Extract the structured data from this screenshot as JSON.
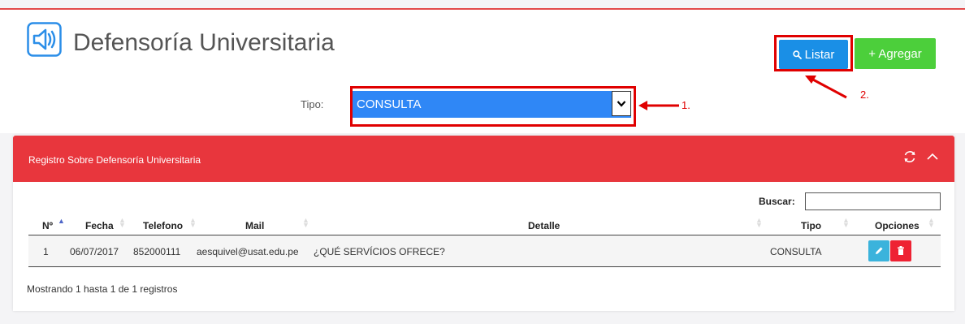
{
  "app": {
    "title": "Defensoría Universitaria"
  },
  "toolbar": {
    "listar_label": "Listar",
    "agregar_label": "+ Agregar"
  },
  "filter": {
    "label": "Tipo:",
    "selected": "CONSULTA"
  },
  "annotations": {
    "a1": "1.",
    "a2": "2."
  },
  "panel": {
    "title": "Registro Sobre Defensoría Universitaria",
    "search_label": "Buscar:",
    "search_value": ""
  },
  "table": {
    "headers": {
      "num": "Nº",
      "fecha": "Fecha",
      "telefono": "Telefono",
      "mail": "Mail",
      "detalle": "Detalle",
      "tipo": "Tipo",
      "opciones": "Opciones"
    },
    "rows": [
      {
        "num": "1",
        "fecha": "06/07/2017",
        "telefono": "852000111",
        "mail": "aesquivel@usat.edu.pe",
        "detalle": "¿QUÉ SERVÍCIOS OFRECE?",
        "tipo": "CONSULTA"
      }
    ]
  },
  "info": "Mostrando 1 hasta 1 de 1 registros",
  "colors": {
    "accent_red": "#e8363d",
    "listar_blue": "#1a8fe6",
    "agregar_green": "#4ccf3b",
    "edit_blue": "#3bb3dc",
    "delete_red": "#ee2233"
  },
  "icons": {
    "logo": "speaker-icon",
    "search": "search-icon",
    "refresh": "refresh-icon",
    "collapse": "chevron-up-icon",
    "edit": "pencil-icon",
    "delete": "trash-icon"
  }
}
